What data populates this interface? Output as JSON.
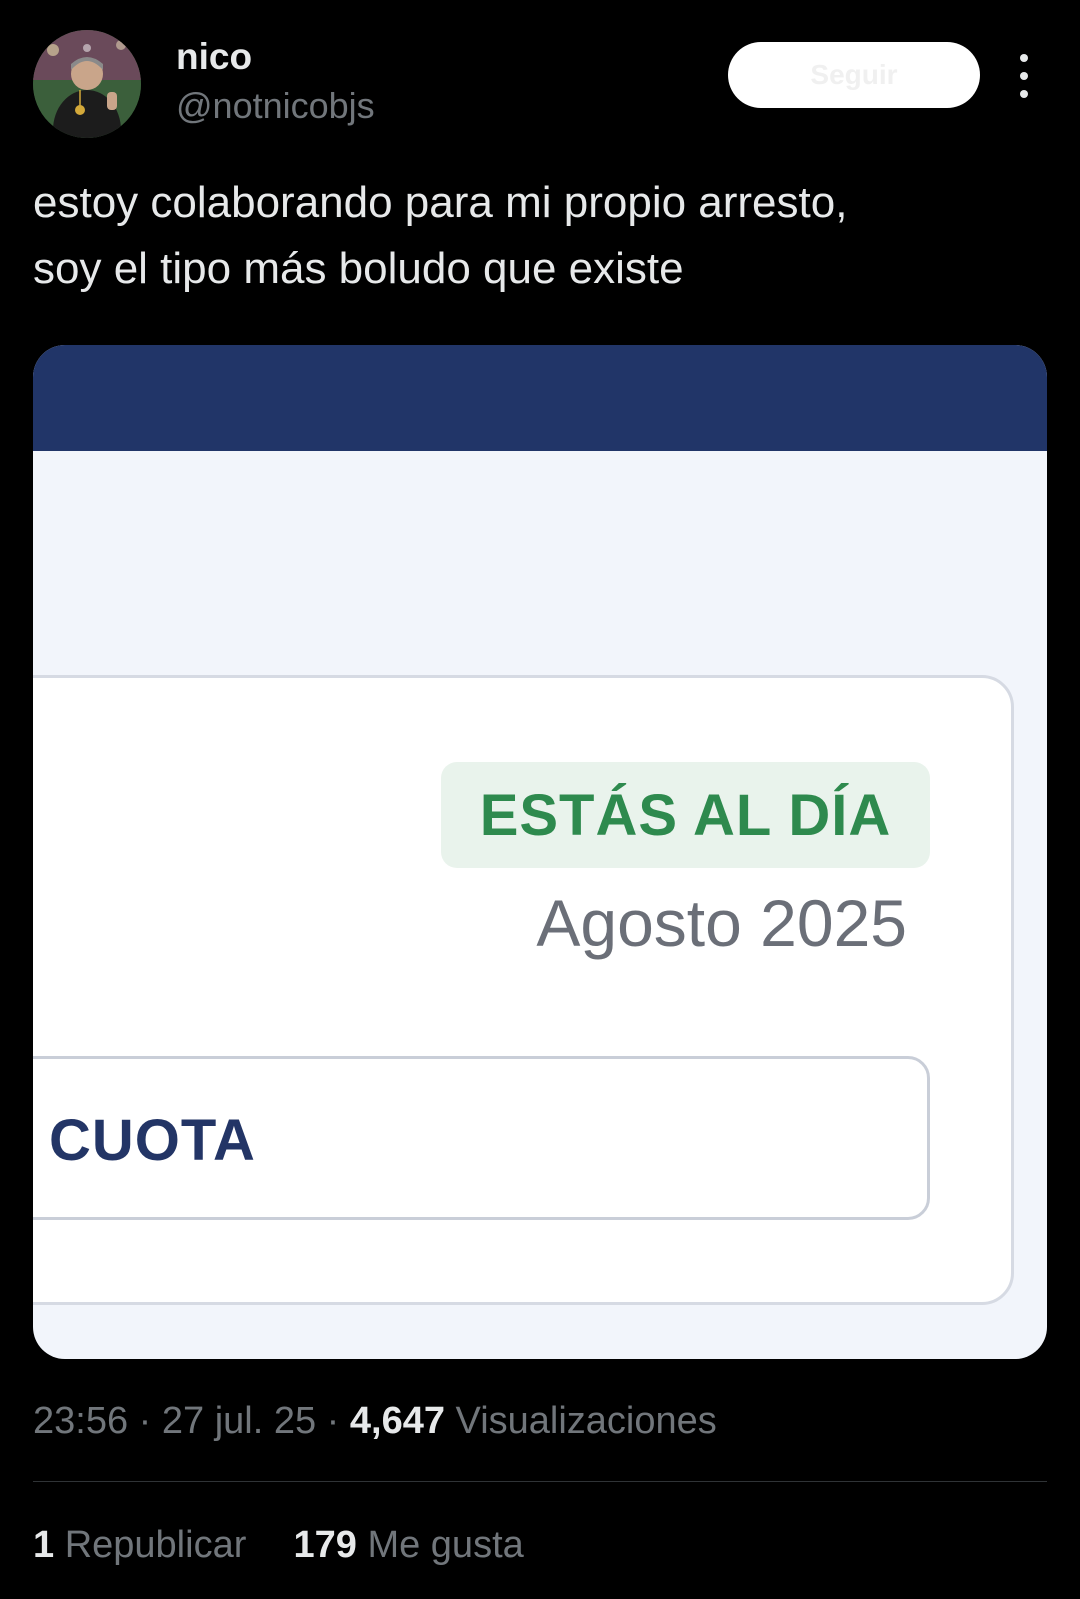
{
  "tweet": {
    "author": {
      "display_name": "nico",
      "handle": "@notnicobjs"
    },
    "follow_button_label": "Seguir",
    "text_lines": [
      "estoy colaborando para mi propio arresto,",
      "soy el tipo más boludo que existe"
    ],
    "media": {
      "status_badge": "ESTÁS AL DÍA",
      "period": "Agosto 2025",
      "cuota_label": "CUOTA"
    },
    "time": "23:56",
    "date": "27 jul. 25",
    "separator": "·",
    "views_count": "4,647",
    "views_label": "Visualizaciones",
    "reposts_count": "1",
    "reposts_label": "Republicar",
    "likes_count": "179",
    "likes_label": "Me gusta"
  },
  "colors": {
    "background": "#000000",
    "primary_text": "#e7e9ea",
    "secondary_text": "#71767b",
    "media_header": "#213568",
    "badge_green": "#2e8a4e",
    "cuota_navy": "#233566"
  },
  "icons": {
    "more": "more-vertical-icon"
  }
}
